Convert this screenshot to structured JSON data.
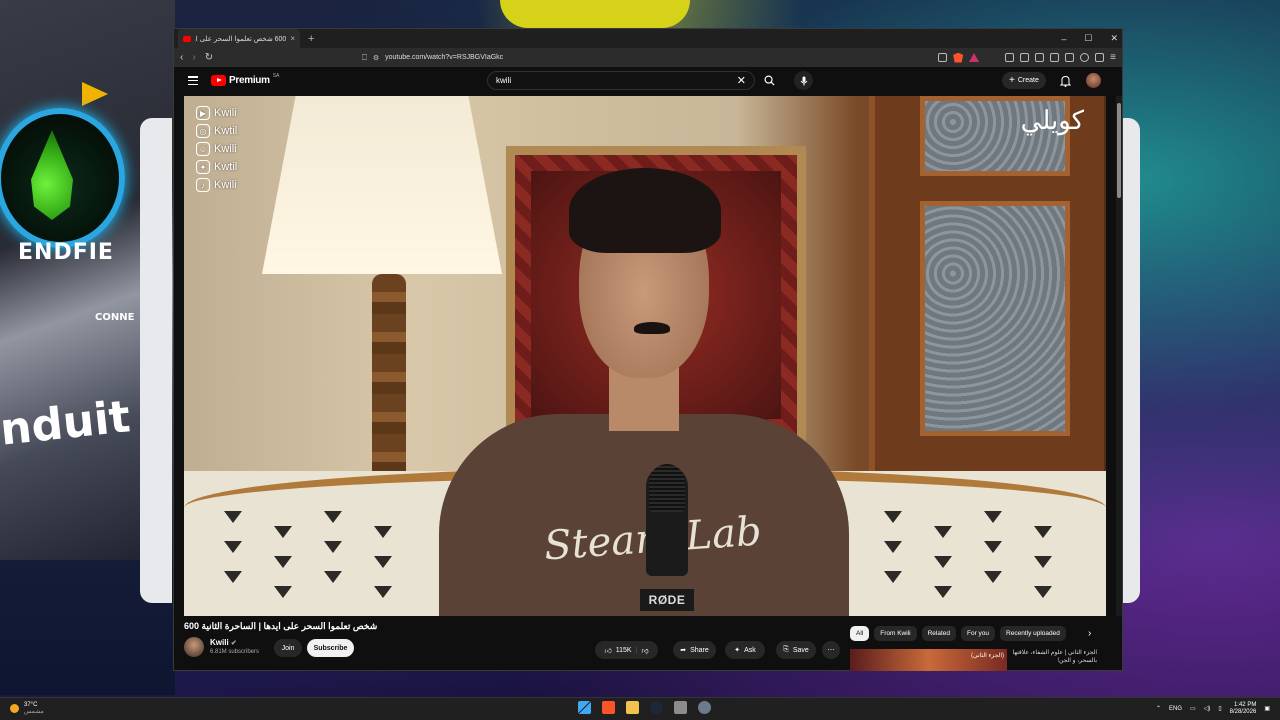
{
  "browser": {
    "tab_title": "600 شخص تعلموا السحر على ايدها...",
    "tab_close": "×",
    "new_tab": "+",
    "window_controls": [
      "–",
      "☐",
      "✕"
    ],
    "url": "youtube.com/watch?v=RSJBGVIaGkc"
  },
  "youtube": {
    "logo_text": "Premium",
    "logo_sup": "SA",
    "search_value": "kwili",
    "create_label": "Create"
  },
  "video": {
    "socials": [
      {
        "icon": "youtube-icon",
        "glyph": "▶",
        "handle": "Kwili"
      },
      {
        "icon": "instagram-icon",
        "glyph": "◎",
        "handle": "Kwtil"
      },
      {
        "icon": "snapchat-icon",
        "glyph": "☺",
        "handle": "Kwili"
      },
      {
        "icon": "twitter-icon",
        "glyph": "✦",
        "handle": "Kwtil"
      },
      {
        "icon": "tiktok-icon",
        "glyph": "♪",
        "handle": "Kwili"
      }
    ],
    "channel_watermark": "كويلي",
    "shirt_text": "Steam Lab",
    "mic_brand": "RØDE"
  },
  "watch": {
    "title": "600 شخص تعلموا السحر على ايدها | الساحرة الثانية",
    "channel_name": "Kwili",
    "subscribers": "6.81M subscribers",
    "join_label": "Join",
    "subscribe_label": "Subscribe",
    "likes": "115K",
    "share_label": "Share",
    "ask_label": "Ask",
    "save_label": "Save",
    "more_label": "⋯"
  },
  "chips": [
    "All",
    "From Kwili",
    "Related",
    "For you",
    "Recently uploaded"
  ],
  "recommendation": {
    "title": "الجزء الثاني | علوم الشفاء، علاقتها بالسحر، و الجن!",
    "badge": "(الجزء الثاني)"
  },
  "taskbar": {
    "temp": "37°C",
    "weather_sub": "مشمس",
    "lang": "ENG",
    "time": "1:42 PM",
    "date": "8/28/2026"
  },
  "desktop": {
    "deco_word": "nduit",
    "deco_brand": "ENDFIE",
    "deco_sub": "CONNE"
  }
}
